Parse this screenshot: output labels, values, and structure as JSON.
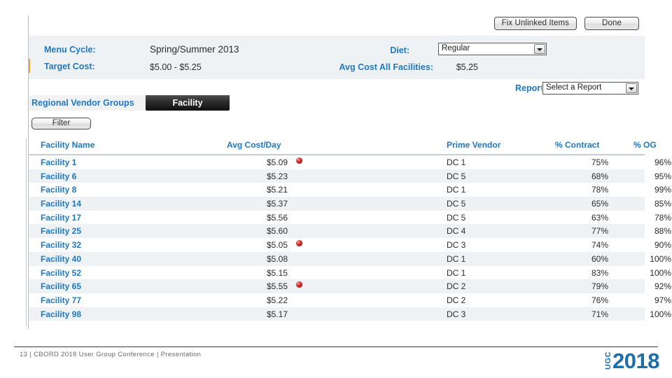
{
  "window": {
    "toolbar": {
      "fix_unlinked_label": "Fix Unlinked Items",
      "done_label": "Done"
    },
    "info": {
      "menu_cycle_label": "Menu Cycle:",
      "menu_cycle_value": "Spring/Summer 2013",
      "target_cost_label": "Target Cost:",
      "target_cost_value": "$5.00 - $5.25",
      "diet_label": "Diet:",
      "diet_value": "Regular",
      "avg_cost_all_label": "Avg Cost All Facilities:",
      "avg_cost_all_value": "$5.25"
    },
    "reports": {
      "label": "Reports:",
      "selected": "Select a Report"
    },
    "tabs": [
      {
        "label": "Regional Vendor Groups",
        "active": false
      },
      {
        "label": "Facility",
        "active": true
      }
    ],
    "filter_label": "Filter",
    "grid": {
      "columns": [
        "Facility Name",
        "Avg Cost/Day",
        "Prime Vendor",
        "% Contract",
        "% OG"
      ],
      "rows": [
        {
          "name": "Facility 1",
          "cost": "$5.09",
          "flag": true,
          "vendor": "DC 1",
          "contract": "75%",
          "og": "96%"
        },
        {
          "name": "Facility 6",
          "cost": "$5.23",
          "flag": false,
          "vendor": "DC 5",
          "contract": "68%",
          "og": "95%"
        },
        {
          "name": "Facility 8",
          "cost": "$5.21",
          "flag": false,
          "vendor": "DC 1",
          "contract": "78%",
          "og": "99%"
        },
        {
          "name": "Facility 14",
          "cost": "$5.37",
          "flag": false,
          "vendor": "DC 5",
          "contract": "65%",
          "og": "85%"
        },
        {
          "name": "Facility 17",
          "cost": "$5.56",
          "flag": false,
          "vendor": "DC 5",
          "contract": "63%",
          "og": "78%"
        },
        {
          "name": "Facility 25",
          "cost": "$5.60",
          "flag": false,
          "vendor": "DC 4",
          "contract": "77%",
          "og": "88%"
        },
        {
          "name": "Facility 32",
          "cost": "$5.05",
          "flag": true,
          "vendor": "DC 3",
          "contract": "74%",
          "og": "90%"
        },
        {
          "name": "Facility 40",
          "cost": "$5.08",
          "flag": false,
          "vendor": "DC 1",
          "contract": "60%",
          "og": "100%"
        },
        {
          "name": "Facility 52",
          "cost": "$5.15",
          "flag": false,
          "vendor": "DC 1",
          "contract": "83%",
          "og": "100%"
        },
        {
          "name": "Facility 65",
          "cost": "$5.55",
          "flag": true,
          "vendor": "DC 2",
          "contract": "79%",
          "og": "92%"
        },
        {
          "name": "Facility 77",
          "cost": "$5.22",
          "flag": false,
          "vendor": "DC 2",
          "contract": "76%",
          "og": "97%"
        },
        {
          "name": "Facility 98",
          "cost": "$5.17",
          "flag": false,
          "vendor": "DC 3",
          "contract": "71%",
          "og": "100%"
        }
      ]
    }
  },
  "slide": {
    "footer_text": "13 | CBORD 2018 User Group Conference | Presentation",
    "logo_mark": "UGC",
    "logo_year": "2018"
  },
  "colors": {
    "label_blue": "#2079c0",
    "logo_blue": "#1b6fa8",
    "band_bg": "#eef2f5",
    "row_alt": "#eef2f5",
    "flag_red": "#c42020",
    "accent_orange": "#e8a33d"
  }
}
